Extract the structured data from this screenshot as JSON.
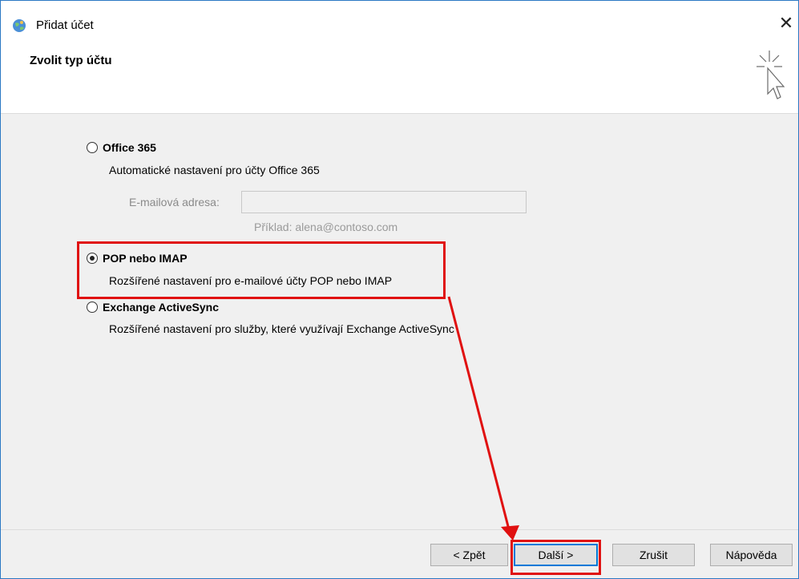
{
  "window": {
    "title": "Přidat účet",
    "close_label": "✕"
  },
  "header": {
    "title": "Zvolit typ účtu"
  },
  "options": [
    {
      "label": "Office 365",
      "description": "Automatické nastavení pro účty Office 365",
      "selected": false
    },
    {
      "label": "POP nebo IMAP",
      "description": "Rozšířené nastavení pro e-mailové účty POP nebo IMAP",
      "selected": true
    },
    {
      "label": "Exchange ActiveSync",
      "description": "Rozšířené nastavení pro služby, které využívají Exchange ActiveSync",
      "selected": false
    }
  ],
  "email": {
    "label": "E-mailová adresa:",
    "value": "",
    "example": "Příklad: alena@contoso.com"
  },
  "buttons": {
    "back": "< Zpět",
    "next": "Další >",
    "cancel": "Zrušit",
    "help": "Nápověda"
  },
  "colors": {
    "highlight": "#e01010",
    "accent": "#0078d7"
  }
}
